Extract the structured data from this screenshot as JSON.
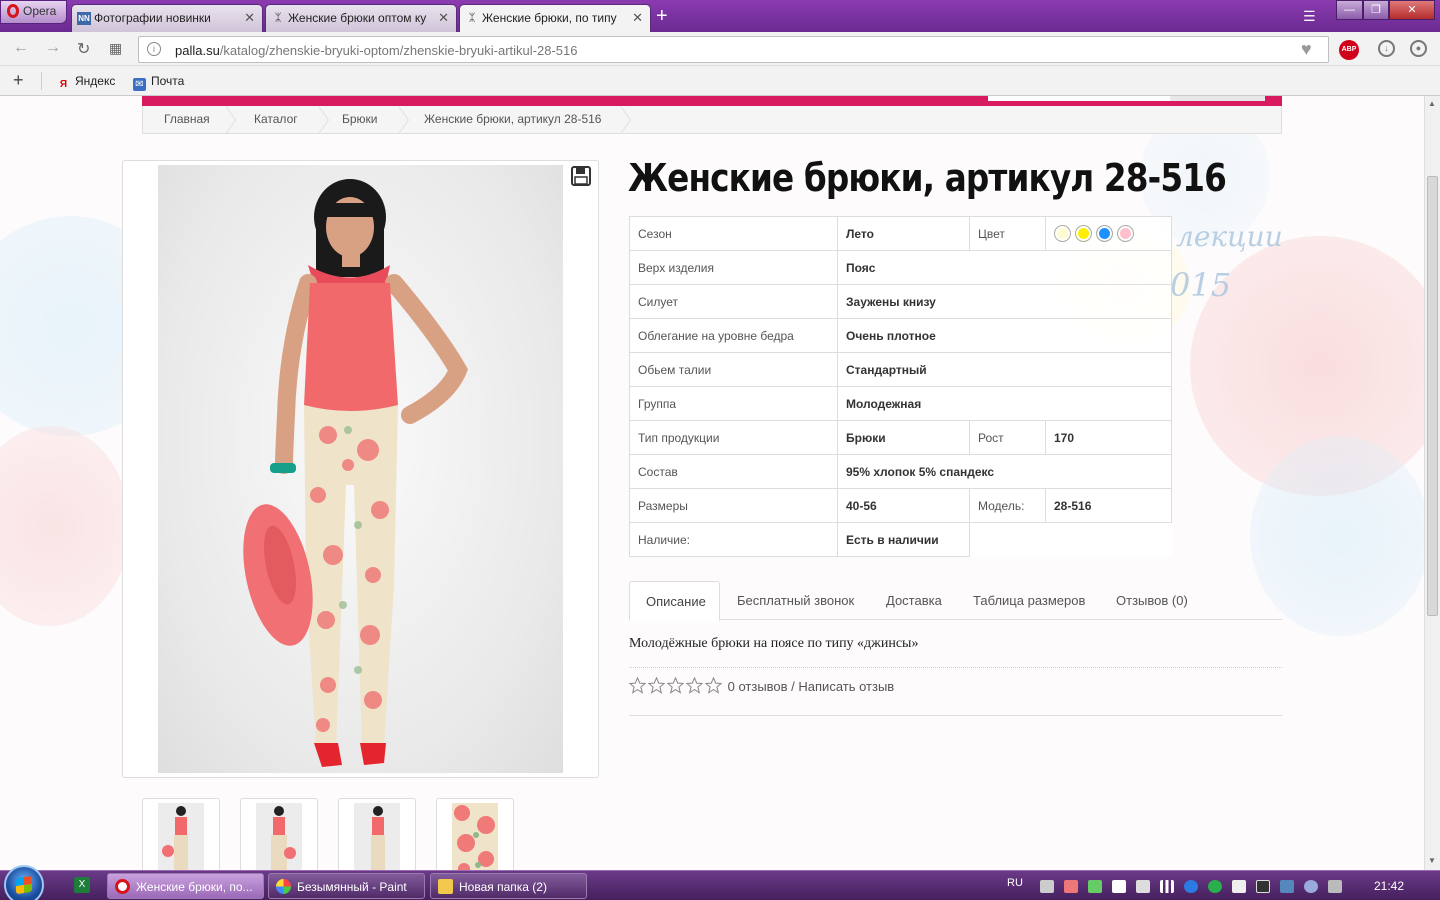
{
  "browser": {
    "menu_label": "Opera",
    "tabs": [
      {
        "title": "Фотографии новинки",
        "active": false
      },
      {
        "title": "Женские брюки оптом ку",
        "active": false
      },
      {
        "title": "Женские брюки, по типу",
        "active": true
      }
    ],
    "url_domain": "palla.su",
    "url_path": "/katalog/zhenskie-bryuki-optom/zhenskie-bryuki-artikul-28-516",
    "abp_label": "ABP",
    "bookmarks": [
      {
        "label": "Яндекс",
        "icon": "yandex-icon"
      },
      {
        "label": "Почта",
        "icon": "mail-icon"
      }
    ]
  },
  "breadcrumb": [
    "Главная",
    "Каталог",
    "Брюки",
    "Женские брюки, артикул 28-516"
  ],
  "background_text": [
    "лекции",
    "015"
  ],
  "product": {
    "title": "Женские брюки, артикул 28-516",
    "specs": {
      "season_label": "Сезон",
      "season_value": "Лето",
      "color_label": "Цвет",
      "colors": [
        "#fffbd0",
        "#ffee00",
        "#1e90ff",
        "#ffc0cb"
      ],
      "top_label": "Верх изделия",
      "top_value": "Пояс",
      "silhouette_label": "Силует",
      "silhouette_value": "Заужены книзу",
      "fit_label": "Облегание на уровне бедра",
      "fit_value": "Очень плотное",
      "waist_label": "Обьем талии",
      "waist_value": "Стандартный",
      "group_label": "Группа",
      "group_value": "Молодежная",
      "type_label": "Тип продукции",
      "type_value": "Брюки",
      "height_label": "Рост",
      "height_value": "170",
      "composition_label": "Состав",
      "composition_value": "95% хлопок 5% спандекс",
      "sizes_label": "Размеры",
      "sizes_value": "40-56",
      "model_label": "Модель:",
      "model_value": "28-516",
      "availability_label": "Наличие:",
      "availability_value": "Есть в наличии"
    },
    "tabs": [
      "Описание",
      "Бесплатный звонок",
      "Доставка",
      "Таблица размеров",
      "Отзывов (0)"
    ],
    "description": "Молодёжные брюки на поясе по типу «джинсы»",
    "rating": {
      "stars": 0,
      "max": 5,
      "text": "0 отзывов / Написать отзыв"
    },
    "thumbnail_count": 4
  },
  "taskbar": {
    "items": [
      {
        "label": "Женские брюки, по...",
        "icon": "opera-icon",
        "active": true
      },
      {
        "label": "Безымянный - Paint",
        "icon": "paint-icon",
        "active": false
      },
      {
        "label": "Новая папка (2)",
        "icon": "folder-icon",
        "active": false
      }
    ],
    "language": "RU",
    "clock": "21:42"
  },
  "colors": {
    "accent": "#d81b60",
    "titlebar": "#7a33a3",
    "taskbar": "#5a2c76"
  }
}
